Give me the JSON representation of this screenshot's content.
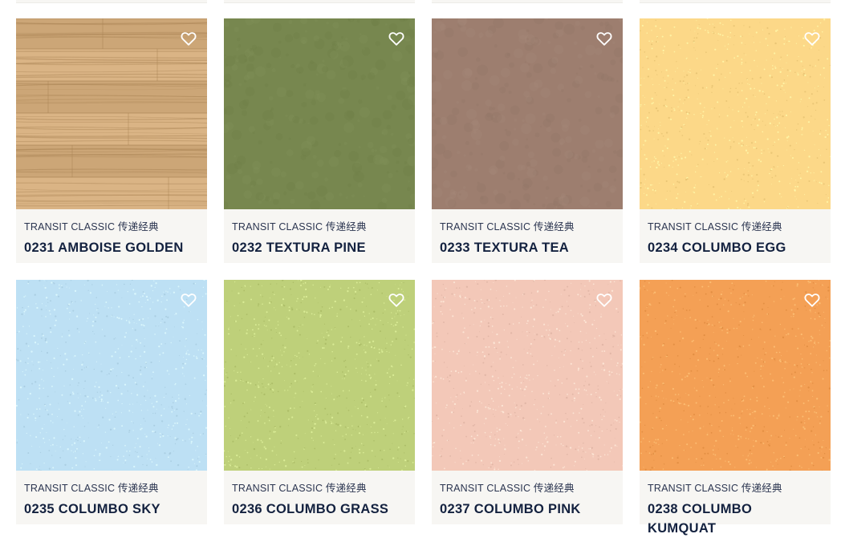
{
  "products": [
    {
      "collection": "TRANSIT CLASSIC 传递经典",
      "name": "0231 AMBOISE GOLDEN",
      "color": "#d2ac7d",
      "texture": "wood",
      "favorite_icon": "heart-outline-icon"
    },
    {
      "collection": "TRANSIT CLASSIC 传递经典",
      "name": "0232 TEXTURA PINE",
      "color": "#77874f",
      "texture": "mottled",
      "favorite_icon": "heart-outline-icon"
    },
    {
      "collection": "TRANSIT CLASSIC 传递经典",
      "name": "0233 TEXTURA TEA",
      "color": "#9d7e6f",
      "texture": "mottled",
      "favorite_icon": "heart-outline-icon"
    },
    {
      "collection": "TRANSIT CLASSIC 传递经典",
      "name": "0234 COLUMBO EGG",
      "color": "#fcd888",
      "texture": "speckled",
      "favorite_icon": "heart-outline-icon"
    },
    {
      "collection": "TRANSIT CLASSIC 传递经典",
      "name": "0235 COLUMBO SKY",
      "color": "#bde0f4",
      "texture": "speckled",
      "favorite_icon": "heart-outline-icon"
    },
    {
      "collection": "TRANSIT CLASSIC 传递经典",
      "name": "0236 COLUMBO GRASS",
      "color": "#bed07a",
      "texture": "speckled",
      "favorite_icon": "heart-outline-icon"
    },
    {
      "collection": "TRANSIT CLASSIC 传递经典",
      "name": "0237 COLUMBO PINK",
      "color": "#f3c8b8",
      "texture": "speckled",
      "favorite_icon": "heart-outline-icon"
    },
    {
      "collection": "TRANSIT CLASSIC 传递经典",
      "name": "0238 COLUMBO KUMQUAT",
      "color": "#f4a055",
      "texture": "speckled",
      "favorite_icon": "heart-outline-icon"
    }
  ]
}
